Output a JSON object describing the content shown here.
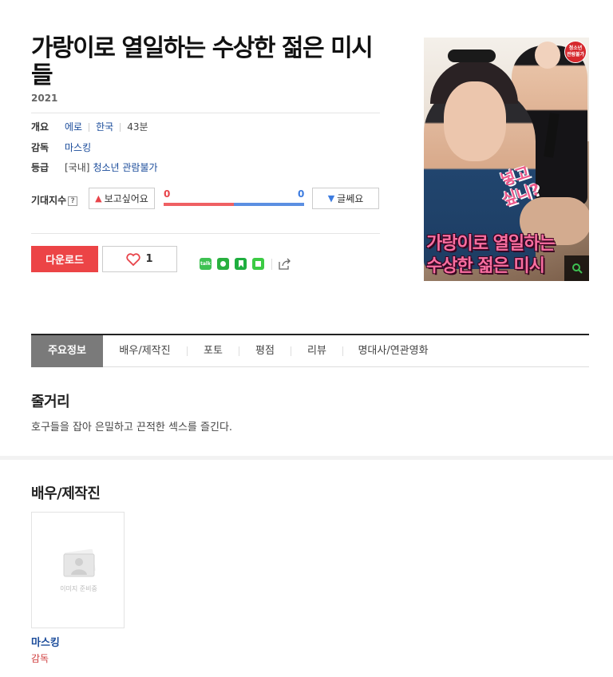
{
  "movie": {
    "title": "가랑이로 열일하는 수상한 젊은 미시들",
    "year": "2021"
  },
  "info": {
    "overview_label": "개요",
    "genre": "에로",
    "country": "한국",
    "runtime": "43분",
    "director_label": "감독",
    "director": "마스킹",
    "rating_label": "등급",
    "rating_prefix": "[국내]",
    "rating": "청소년 관람불가"
  },
  "expectation": {
    "label": "기대지수",
    "help": "?",
    "want_label": "보고싶어요",
    "want_count": "0",
    "nope_label": "글쎄요",
    "nope_count": "0",
    "want_share": 0.5
  },
  "actions": {
    "download_label": "다운로드",
    "like_count": "1",
    "share_icons": [
      "kakaotalk-icon",
      "band-icon",
      "bookmark-icon",
      "memo-icon",
      "share-icon"
    ],
    "kakao_text": "talk"
  },
  "poster": {
    "badge": "청소년\n관람불가",
    "vertical_text": [
      "넣고",
      "싶니?"
    ],
    "caption_line1": "가랑이로 열일하는",
    "caption_line2": "수상한 젊은 미시"
  },
  "tabs": [
    "주요정보",
    "배우/제작진",
    "포토",
    "평점",
    "리뷰",
    "명대사/연관영화"
  ],
  "synopsis": {
    "title": "줄거리",
    "text": "호구들을 잡아 은밀하고 끈적한 섹스를 즐긴다."
  },
  "cast": {
    "title": "배우/제작진",
    "placeholder_text": "이미지 준비중",
    "members": [
      {
        "name": "마스킹",
        "role": "감독"
      }
    ]
  },
  "colors": {
    "accent_red": "#ec4446",
    "blue_link": "#1a4b9a",
    "want_red": "#ef6063",
    "nope_blue": "#5b8fe2"
  }
}
